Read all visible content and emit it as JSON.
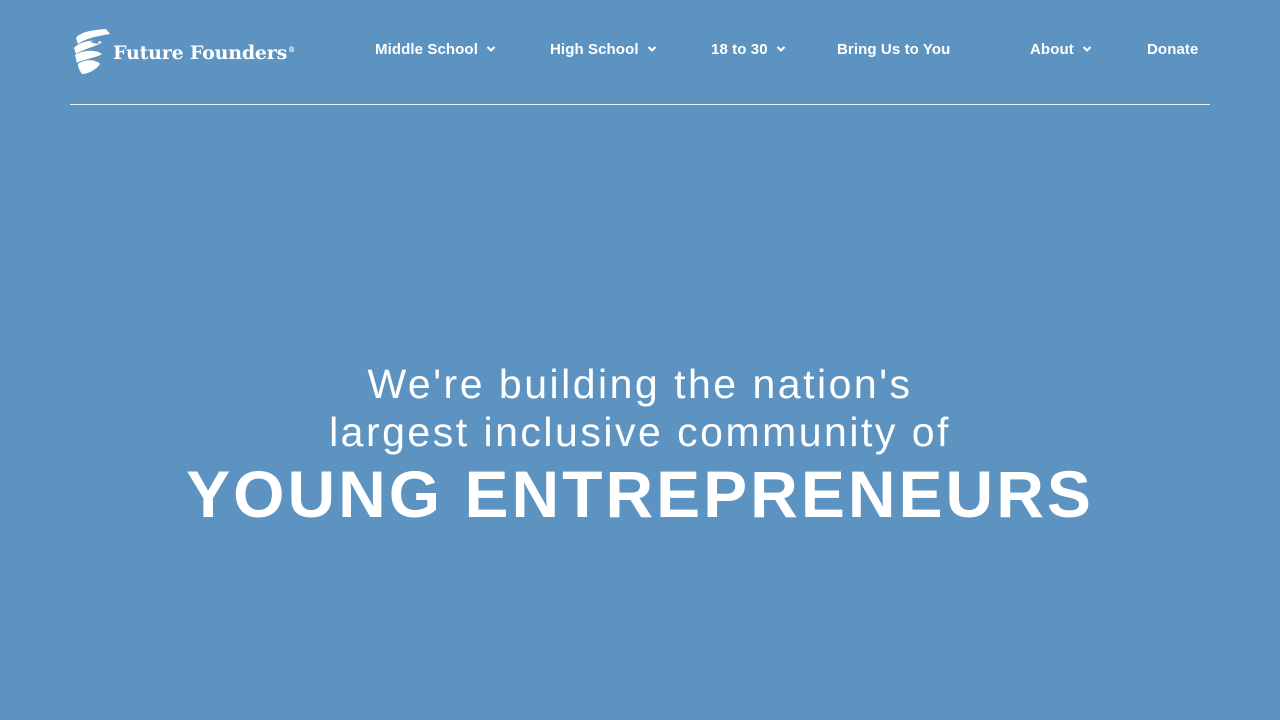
{
  "brand": {
    "name": "Future Founders",
    "reg_mark": "®",
    "logo_icon": "swirl-flag-icon"
  },
  "nav": {
    "items": [
      {
        "label": "Middle School",
        "has_dropdown": true
      },
      {
        "label": "High School",
        "has_dropdown": true
      },
      {
        "label": "18 to 30",
        "has_dropdown": true
      },
      {
        "label": "Bring Us to You",
        "has_dropdown": false
      },
      {
        "label": "About",
        "has_dropdown": true
      },
      {
        "label": "Donate",
        "has_dropdown": false
      }
    ]
  },
  "hero": {
    "line1": "We're building the nation's",
    "line2": "largest inclusive community of",
    "headline": "YOUNG ENTREPRENEURS"
  },
  "colors": {
    "background": "#5d93c1",
    "text": "#ffffff"
  }
}
